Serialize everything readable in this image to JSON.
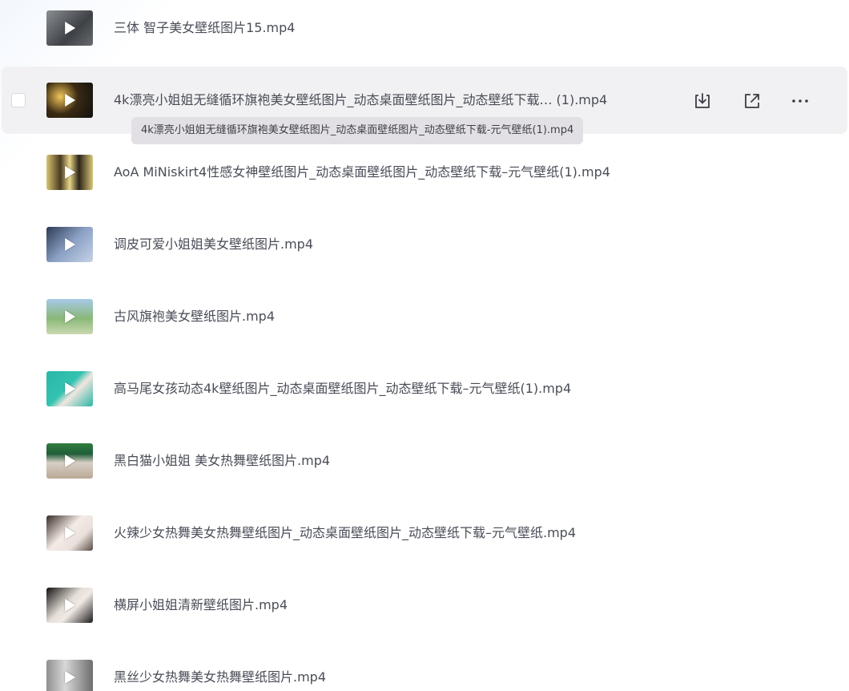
{
  "files": [
    {
      "name": "三体 智子美女壁纸图片15.mp4",
      "thumb_icon": "video-thumbnail",
      "play_icon": "play-icon"
    },
    {
      "name": "4k漂亮小姐姐无缝循环旗袍美女壁纸图片_动态桌面壁纸图片_动态壁纸下载… (1).mp4",
      "thumb_icon": "video-thumbnail",
      "play_icon": "play-icon"
    },
    {
      "name": "AoA MiNiskirt4性感女神壁纸图片_动态桌面壁纸图片_动态壁纸下载–元气壁纸(1).mp4",
      "thumb_icon": "video-thumbnail",
      "play_icon": "play-icon"
    },
    {
      "name": "调皮可爱小姐姐美女壁纸图片.mp4",
      "thumb_icon": "video-thumbnail",
      "play_icon": "play-icon"
    },
    {
      "name": "古风旗袍美女壁纸图片.mp4",
      "thumb_icon": "video-thumbnail",
      "play_icon": "play-icon"
    },
    {
      "name": "高马尾女孩动态4k壁纸图片_动态桌面壁纸图片_动态壁纸下载–元气壁纸(1).mp4",
      "thumb_icon": "video-thumbnail",
      "play_icon": "play-icon"
    },
    {
      "name": "黑白猫小姐姐 美女热舞壁纸图片.mp4",
      "thumb_icon": "video-thumbnail",
      "play_icon": "play-icon"
    },
    {
      "name": "火辣少女热舞美女热舞壁纸图片_动态桌面壁纸图片_动态壁纸下载–元气壁纸.mp4",
      "thumb_icon": "video-thumbnail",
      "play_icon": "play-icon"
    },
    {
      "name": "横屏小姐姐清新壁纸图片.mp4",
      "thumb_icon": "video-thumbnail",
      "play_icon": "play-icon"
    },
    {
      "name": "黑丝少女热舞美女热舞壁纸图片.mp4",
      "thumb_icon": "video-thumbnail",
      "play_icon": "play-icon"
    }
  ],
  "hovered_row": {
    "checkbox_checked": false,
    "actions": [
      {
        "icon": "download-icon"
      },
      {
        "icon": "share-icon"
      },
      {
        "icon": "more-icon"
      }
    ]
  },
  "tooltip": {
    "text": "4k漂亮小姐姐无缝循环旗袍美女壁纸图片_动态桌面壁纸图片_动态壁纸下载-元气壁纸(1).mp4"
  },
  "colors": {
    "hover_background": "#f1f1f3",
    "text": "#4a4d57",
    "tooltip_background": "#e2e0e4",
    "icon": "#3b3d45"
  }
}
